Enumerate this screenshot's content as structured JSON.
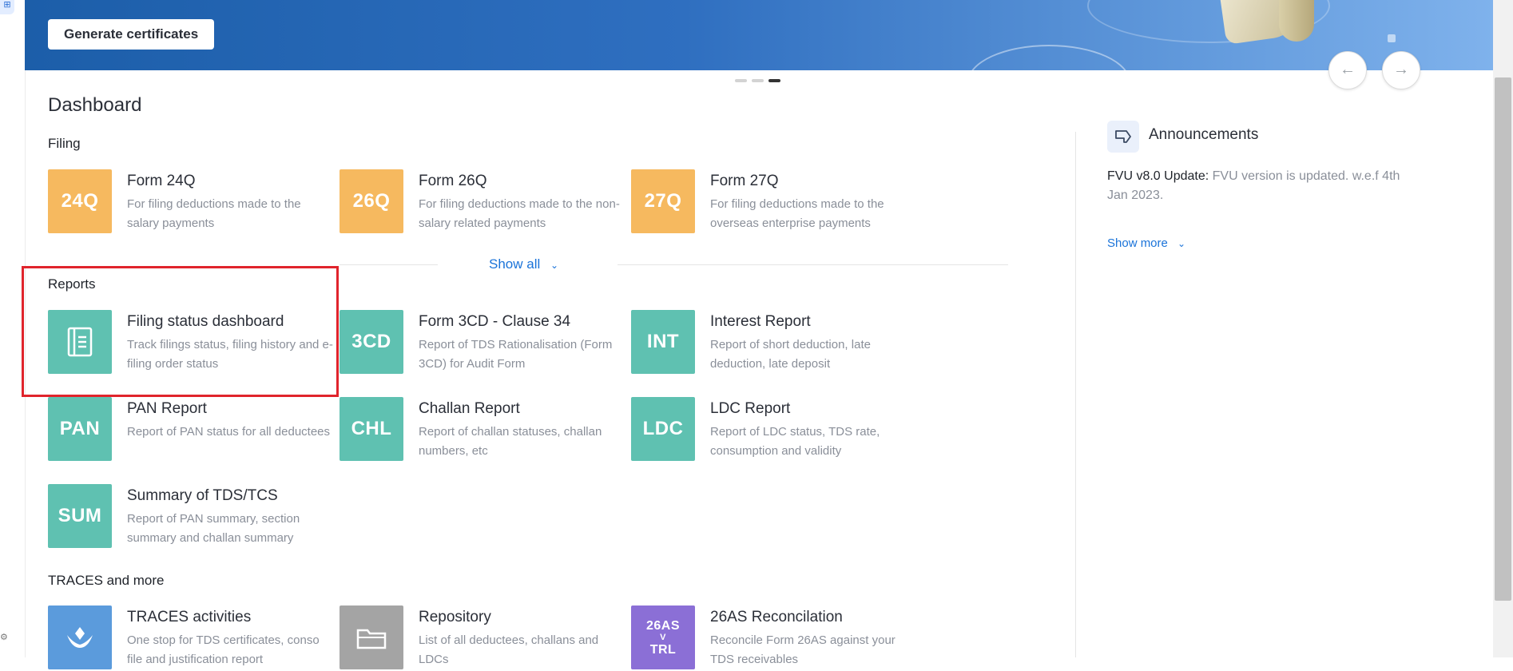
{
  "banner": {
    "button_label": "Generate certificates",
    "prev_icon": "←",
    "next_icon": "→"
  },
  "dashboard": {
    "title": "Dashboard",
    "sections": {
      "filing": {
        "title": "Filing",
        "tiles": [
          {
            "icon_text": "24Q",
            "name": "Form 24Q",
            "desc": "For filing deductions made to the salary payments"
          },
          {
            "icon_text": "26Q",
            "name": "Form 26Q",
            "desc": "For filing deductions made to the non-salary related payments"
          },
          {
            "icon_text": "27Q",
            "name": "Form 27Q",
            "desc": "For filing deductions made to the overseas enterprise payments"
          }
        ],
        "show_all": "Show all"
      },
      "reports": {
        "title": "Reports",
        "tiles": [
          {
            "icon_text": "",
            "icon": "document-icon",
            "name": "Filing status dashboard",
            "desc": "Track filings status, filing history and e-filing order status"
          },
          {
            "icon_text": "3CD",
            "name": "Form 3CD - Clause 34",
            "desc": "Report of TDS Rationalisation (Form 3CD) for Audit Form"
          },
          {
            "icon_text": "INT",
            "name": "Interest Report",
            "desc": "Report of short deduction, late deduction, late deposit"
          },
          {
            "icon_text": "PAN",
            "name": "PAN Report",
            "desc": "Report of PAN status for all deductees"
          },
          {
            "icon_text": "CHL",
            "name": "Challan Report",
            "desc": "Report of challan statuses, challan numbers, etc"
          },
          {
            "icon_text": "LDC",
            "name": "LDC Report",
            "desc": "Report of LDC status, TDS rate, consumption and validity"
          },
          {
            "icon_text": "SUM",
            "name": "Summary of TDS/TCS",
            "desc": "Report of PAN summary, section summary and challan summary"
          }
        ]
      },
      "traces": {
        "title": "TRACES and more",
        "tiles": [
          {
            "icon": "traces-logo-icon",
            "name": "TRACES activities",
            "desc": "One stop for TDS certificates, conso file and justification report"
          },
          {
            "icon": "folder-icon",
            "name": "Repository",
            "desc": "List of all deductees, challans and LDCs"
          },
          {
            "icon_text_top": "26AS",
            "icon_text_mid": "V",
            "icon_text_bottom": "TRL",
            "name": "26AS Reconcilation",
            "desc": "Reconcile Form 26AS against your TDS receivables"
          }
        ]
      }
    }
  },
  "announcements": {
    "title": "Announcements",
    "item_label": "FVU v8.0 Update:",
    "item_text": " FVU version is updated. w.e.f 4th Jan 2023.",
    "show_more": "Show more"
  },
  "colors": {
    "filing": "#f6b95f",
    "reports": "#5fc1b1",
    "traces": "#5b9bdc",
    "repository": "#a4a4a4",
    "reconcile": "#8b6fd6",
    "link": "#1a73d9",
    "highlight": "#e0242c"
  }
}
